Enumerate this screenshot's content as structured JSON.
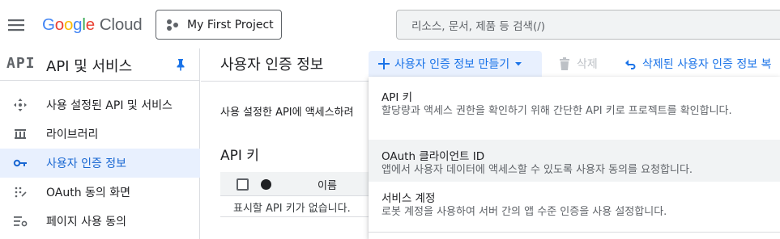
{
  "topbar": {
    "logo_letters": [
      "G",
      "o",
      "o",
      "g",
      "l",
      "e"
    ],
    "logo_suffix": "Cloud",
    "project_label": "My First Project",
    "search_placeholder": "리소스, 문서, 제품 등 검색(/)"
  },
  "sidebar": {
    "api_badge": "API",
    "title": "API 및 서비스",
    "items": [
      {
        "label": "사용 설정된 API 및 서비스",
        "icon": "enabled-apis-icon",
        "active": false
      },
      {
        "label": "라이브러리",
        "icon": "library-icon",
        "active": false
      },
      {
        "label": "사용자 인증 정보",
        "icon": "key-icon",
        "active": true
      },
      {
        "label": "OAuth 동의 화면",
        "icon": "oauth-consent-icon",
        "active": false
      },
      {
        "label": "페이지 사용 동의",
        "icon": "page-usage-agreement-icon",
        "active": false
      }
    ]
  },
  "main": {
    "page_title": "사용자 인증 정보",
    "create_button": "사용자 인증 정보 만들기",
    "delete_button": "삭제",
    "restore_button": "삭제된 사용자 인증 정보 복",
    "description": "사용 설정한 API에 액세스하려",
    "api_keys_title": "API 키",
    "table_column_name": "이름",
    "empty_message": "표시할 API 키가 없습니다."
  },
  "dropdown": {
    "items": [
      {
        "title": "API 키",
        "description": "할당량과 액세스 권한을 확인하기 위해 간단한 API 키로 프로젝트를 확인합니다."
      },
      {
        "title": "OAuth 클라이언트 ID",
        "description": "앱에서 사용자 데이터에 액세스할 수 있도록 사용자 동의를 요청합니다."
      },
      {
        "title": "서비스 계정",
        "description": "로봇 계정을 사용하여 서버 간의 앱 수준 인증을 사용 설정합니다."
      }
    ]
  },
  "colors": {
    "accent": "#1a73e8",
    "active_bg": "#e8f0fe",
    "disabled": "#bdc1c6"
  }
}
